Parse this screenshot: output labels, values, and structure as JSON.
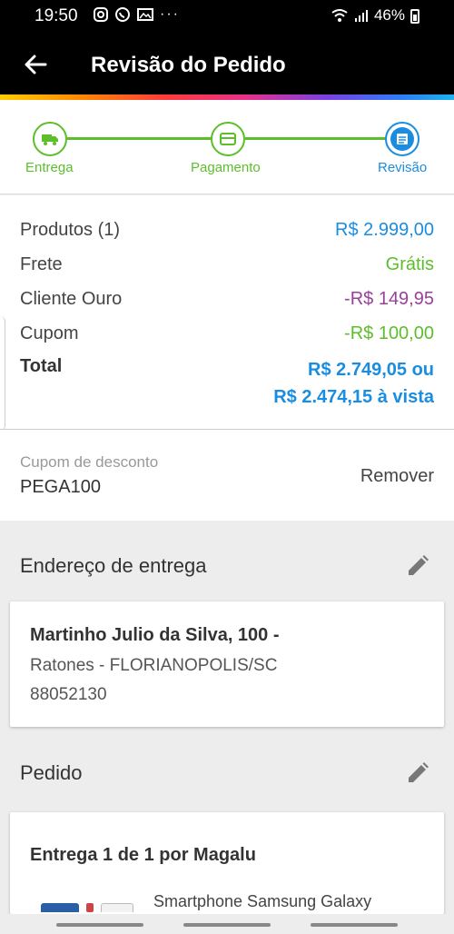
{
  "status_bar": {
    "time": "19:50",
    "notification_icons": [
      "instagram-icon",
      "whatsapp-icon",
      "gallery-icon",
      "more-dots-icon"
    ],
    "battery": "46%",
    "icons": [
      "wifi-icon",
      "signal-icon",
      "battery-icon"
    ]
  },
  "header": {
    "title": "Revisão do Pedido",
    "back_icon": "arrow-left-icon"
  },
  "stepper": {
    "steps": [
      {
        "label": "Entrega",
        "icon": "truck-icon",
        "state": "completed"
      },
      {
        "label": "Pagamento",
        "icon": "card-icon",
        "state": "completed"
      },
      {
        "label": "Revisão",
        "icon": "list-icon",
        "state": "current"
      }
    ],
    "colors": {
      "completed": "#5cbf2a",
      "current": "#1a8de0"
    }
  },
  "summary": {
    "products_label": "Produtos (1)",
    "products_value": "R$ 2.999,00",
    "shipping_label": "Frete",
    "shipping_value": "Grátis",
    "gold_label": "Cliente Ouro",
    "gold_value": "-R$ 149,95",
    "coupon_label": "Cupom",
    "coupon_value": "-R$ 100,00",
    "total_label": "Total",
    "total_value_1": "R$ 2.749,05 ou",
    "total_value_2": "R$ 2.474,15 à vista"
  },
  "coupon": {
    "label": "Cupom de desconto",
    "code": "PEGA100",
    "remove": "Remover"
  },
  "address": {
    "title": "Endereço de entrega",
    "name": "Martinho Julio da Silva, 100 -",
    "line1": "Ratones - FLORIANOPOLIS/SC",
    "zip": "88052130"
  },
  "order": {
    "title": "Pedido",
    "delivery": "Entrega 1 de 1 por Magalu",
    "product": "Smartphone Samsung Galaxy"
  }
}
